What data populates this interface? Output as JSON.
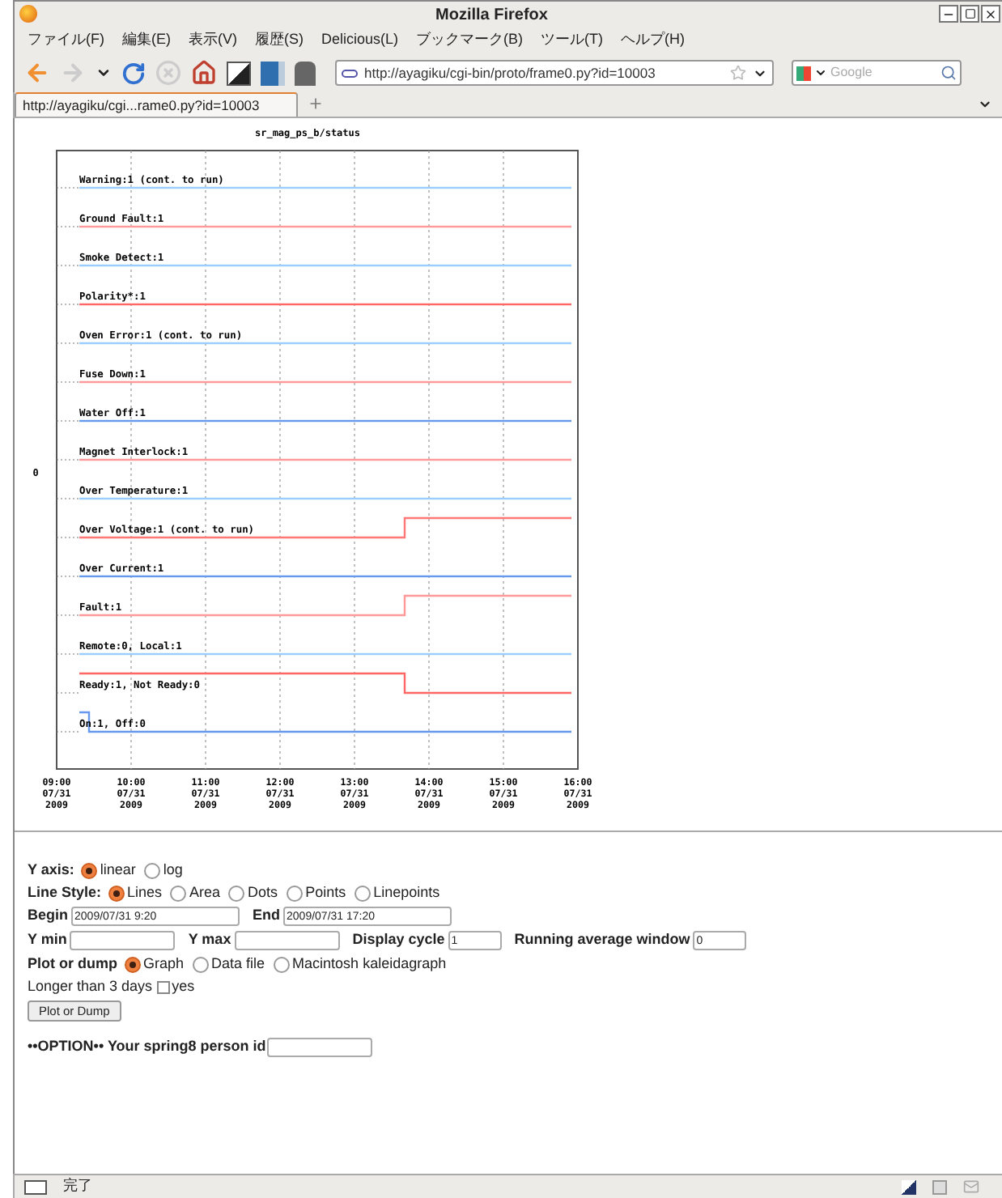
{
  "window": {
    "title": "Mozilla Firefox"
  },
  "menu": [
    "ファイル(F)",
    "編集(E)",
    "表示(V)",
    "履歴(S)",
    "Delicious(L)",
    "ブックマーク(B)",
    "ツール(T)",
    "ヘルプ(H)"
  ],
  "toolbar": {
    "url": "http://ayagiku/cgi-bin/proto/frame0.py?id=10003",
    "search_placeholder": "Google"
  },
  "tabs": [
    {
      "label": "http://ayagiku/cgi...rame0.py?id=10003",
      "selected": true
    }
  ],
  "chart": {
    "title": "sr_mag_ps_b/status",
    "ylabel": "0",
    "traces": [
      {
        "label": "Warning:1 (cont. to run)",
        "color": "#99ccff",
        "kind": "flat"
      },
      {
        "label": "Ground Fault:1",
        "color": "#ff9999",
        "kind": "flat"
      },
      {
        "label": "Smoke Detect:1",
        "color": "#99ccff",
        "kind": "flat"
      },
      {
        "label": "Polarity*:1",
        "color": "#ff6666",
        "kind": "flat"
      },
      {
        "label": "Oven Error:1 (cont. to run)",
        "color": "#99ccff",
        "kind": "flat"
      },
      {
        "label": "Fuse Down:1",
        "color": "#ff9999",
        "kind": "flat"
      },
      {
        "label": "Water Off:1",
        "color": "#6699ee",
        "kind": "flat"
      },
      {
        "label": "Magnet Interlock:1",
        "color": "#ff9999",
        "kind": "flat"
      },
      {
        "label": "Over Temperature:1",
        "color": "#99ccff",
        "kind": "flat"
      },
      {
        "label": "Over Voltage:1 (cont. to  run)",
        "color": "#ff7777",
        "kind": "step_up"
      },
      {
        "label": "Over Current:1",
        "color": "#6699ee",
        "kind": "flat"
      },
      {
        "label": "Fault:1",
        "color": "#ff9999",
        "kind": "step_up"
      },
      {
        "label": "Remote:0, Local:1",
        "color": "#99ccff",
        "kind": "flat"
      },
      {
        "label": "Ready:1, Not Ready:0",
        "color": "#ff6666",
        "kind": "step_down"
      },
      {
        "label": "On:1, Off:0",
        "color": "#6699ee",
        "kind": "blip"
      }
    ],
    "xticks": [
      {
        "time": "09:00",
        "date": "07/31",
        "year": "2009"
      },
      {
        "time": "10:00",
        "date": "07/31",
        "year": "2009"
      },
      {
        "time": "11:00",
        "date": "07/31",
        "year": "2009"
      },
      {
        "time": "12:00",
        "date": "07/31",
        "year": "2009"
      },
      {
        "time": "13:00",
        "date": "07/31",
        "year": "2009"
      },
      {
        "time": "14:00",
        "date": "07/31",
        "year": "2009"
      },
      {
        "time": "15:00",
        "date": "07/31",
        "year": "2009"
      },
      {
        "time": "16:00",
        "date": "07/31",
        "year": "2009"
      }
    ]
  },
  "form": {
    "y_axis": {
      "label": "Y axis:",
      "options": [
        {
          "label": "linear",
          "selected": true
        },
        {
          "label": "log",
          "selected": false
        }
      ]
    },
    "line_style": {
      "label": "Line Style:",
      "options": [
        {
          "label": "Lines",
          "selected": true
        },
        {
          "label": "Area",
          "selected": false
        },
        {
          "label": "Dots",
          "selected": false
        },
        {
          "label": "Points",
          "selected": false
        },
        {
          "label": "Linepoints",
          "selected": false
        }
      ]
    },
    "begin": {
      "label": "Begin",
      "value": "2009/07/31 9:20"
    },
    "end": {
      "label": "End",
      "value": "2009/07/31 17:20"
    },
    "y_min": {
      "label": "Y min"
    },
    "y_max": {
      "label": "Y max"
    },
    "display_cycle": {
      "label": "Display cycle",
      "value": "1"
    },
    "running_average": {
      "label": "Running average window",
      "value": "0"
    },
    "plot_or_dump": {
      "label": "Plot or dump",
      "options": [
        {
          "label": "Graph",
          "selected": true
        },
        {
          "label": "Data file",
          "selected": false
        },
        {
          "label": "Macintosh kaleidagraph",
          "selected": false
        }
      ]
    },
    "longer": {
      "label": "Longer than 3 days",
      "option": "yes",
      "checked": false
    },
    "button": "Plot or Dump",
    "option": {
      "label": "••OPTION•• Your spring8 person id"
    }
  },
  "status_bar": {
    "text": "完了"
  }
}
